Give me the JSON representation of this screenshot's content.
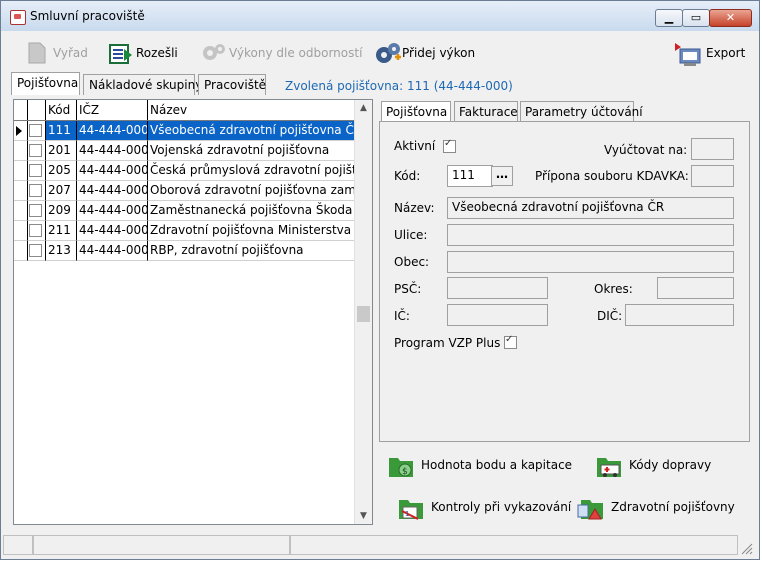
{
  "window": {
    "title": "Smluvní pracoviště"
  },
  "toolbar": {
    "vyrad": "Vyřad",
    "rozesli": "Rozešli",
    "vykony": "Výkony dle odborností",
    "pridej": "Přidej výkon",
    "export": "Export"
  },
  "tabs": [
    "Pojišťovna",
    "Nákladové skupiny",
    "Pracoviště"
  ],
  "selected_info": "Zvolená pojišťovna: 111 (44-444-000)",
  "grid": {
    "headers": [
      "Kód",
      "IČZ",
      "Název"
    ],
    "rows": [
      {
        "kod": "111",
        "icz": "44-444-000",
        "nazev": "Všeobecná zdravotní pojišťovna ČR"
      },
      {
        "kod": "201",
        "icz": "44-444-000",
        "nazev": "Vojenská zdravotní pojišťovna"
      },
      {
        "kod": "205",
        "icz": "44-444-000",
        "nazev": "Česká průmyslová zdravotní pojišťovn"
      },
      {
        "kod": "207",
        "icz": "44-444-000",
        "nazev": "Oborová zdravotní pojišťovna zaměstn"
      },
      {
        "kod": "209",
        "icz": "44-444-000",
        "nazev": "Zaměstnanecká pojišťovna Škoda"
      },
      {
        "kod": "211",
        "icz": "44-444-000",
        "nazev": "Zdravotní pojišťovna Ministerstva vnitra"
      },
      {
        "kod": "213",
        "icz": "44-444-000",
        "nazev": "RBP, zdravotní pojišťovna"
      }
    ]
  },
  "detail_tabs": [
    "Pojišťovna",
    "Fakturace",
    "Parametry účtování"
  ],
  "form": {
    "aktivni": "Aktivní",
    "vyuctovat": "Vyúčtovat na:",
    "kod_label": "Kód:",
    "kod_value": "111",
    "pripona": "Přípona souboru KDAVKA:",
    "nazev_label": "Název:",
    "nazev_value": "Všeobecná zdravotní pojišťovna ČR",
    "ulice": "Ulice:",
    "obec": "Obec:",
    "psc": "PSČ:",
    "okres": "Okres:",
    "ic": "IČ:",
    "dic": "DIČ:",
    "program": "Program VZP Plus"
  },
  "buttons": {
    "hodnota": "Hodnota bodu a kapitace",
    "kody": "Kódy dopravy",
    "kontroly": "Kontroly při vykazování",
    "zdravotni": "Zdravotní pojišťovny"
  }
}
